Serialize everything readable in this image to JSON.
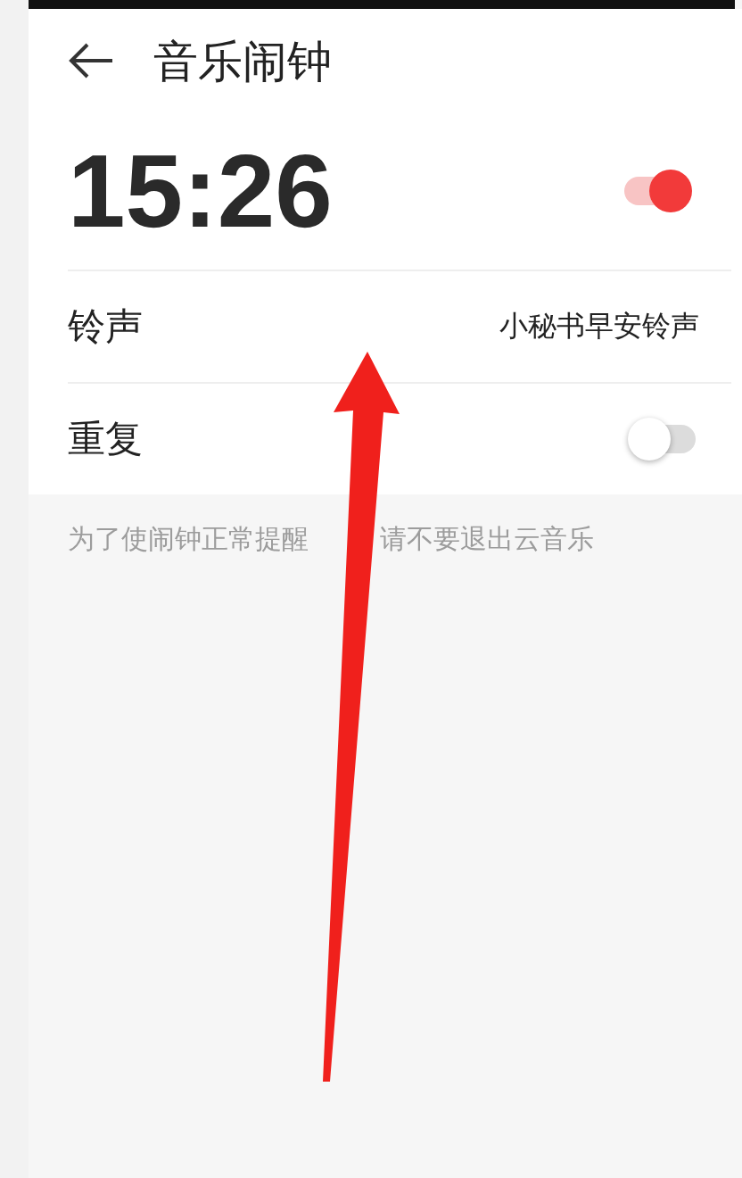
{
  "header": {
    "title": "音乐闹钟"
  },
  "alarm": {
    "time": "15:26",
    "on": true
  },
  "settings": [
    {
      "kind": "value",
      "label": "铃声",
      "value": "小秘书早安铃声"
    },
    {
      "kind": "toggle",
      "label": "重复",
      "on": false
    }
  ],
  "hint": [
    "为了使闹钟正常提醒",
    "请不要退出云音乐"
  ]
}
